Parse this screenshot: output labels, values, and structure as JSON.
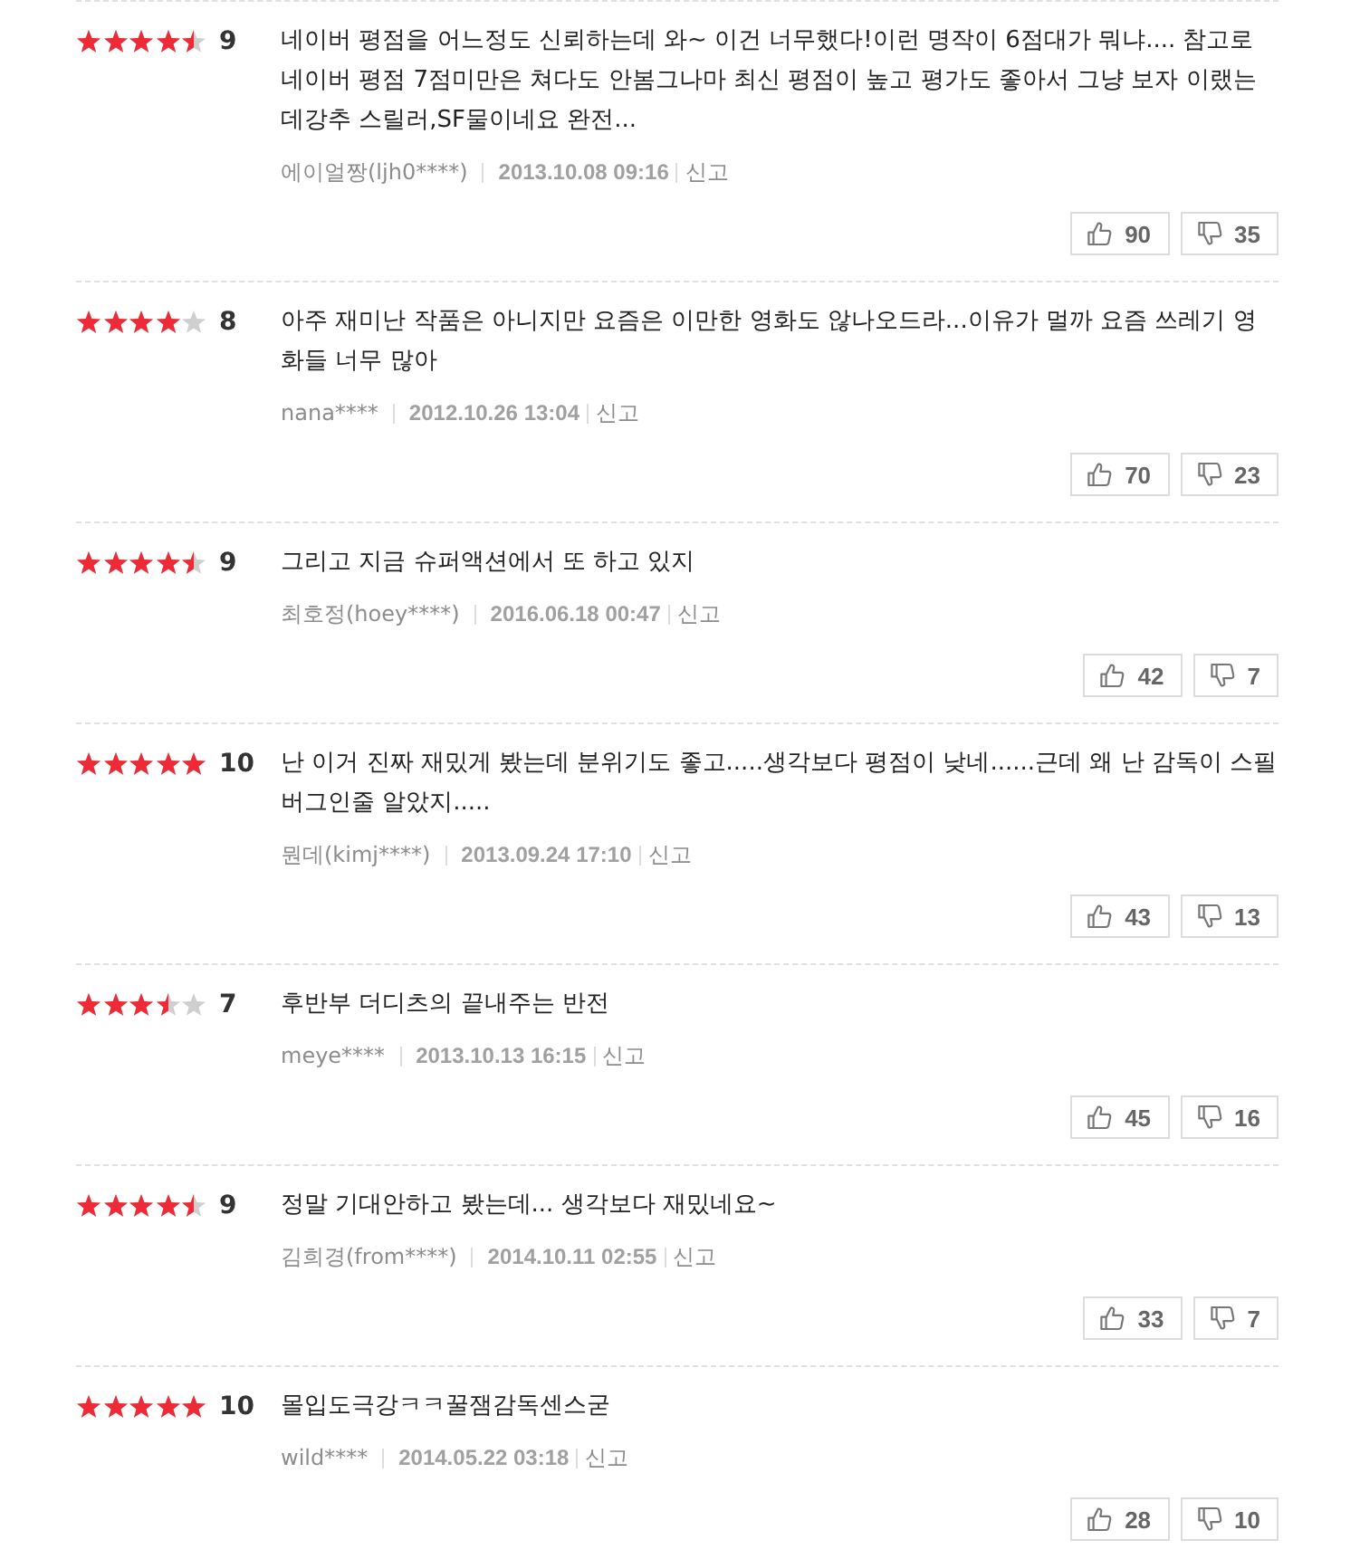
{
  "reviews": [
    {
      "stars": 4.5,
      "score": "9",
      "text": "네이버 평점을 어느정도 신뢰하는데 와~ 이건 너무했다!이런 명작이 6점대가 뭐냐.... 참고로 네이버 평점 7점미만은 쳐다도 안봄그나마 최신 평점이 높고 평가도 좋아서 그냥 보자 이랬는데강추 스릴러,SF물이네요 완전...",
      "author": "에이얼짱(ljh0****)",
      "date": "2013.10.08 09:16",
      "report": "신고",
      "likes": "90",
      "dislikes": "35"
    },
    {
      "stars": 4,
      "score": "8",
      "text": "아주 재미난 작품은 아니지만 요즘은 이만한 영화도 않나오드라...이유가 멀까 요즘 쓰레기 영화들 너무 많아",
      "author": "nana****",
      "date": "2012.10.26 13:04",
      "report": "신고",
      "likes": "70",
      "dislikes": "23"
    },
    {
      "stars": 4.5,
      "score": "9",
      "text": "그리고 지금 슈퍼액션에서 또 하고 있지",
      "author": "최호정(hoey****)",
      "date": "2016.06.18 00:47",
      "report": "신고",
      "likes": "42",
      "dislikes": "7"
    },
    {
      "stars": 5,
      "score": "10",
      "text": "난 이거 진짜 재밌게 봤는데 분위기도 좋고.....생각보다 평점이 낮네......근데 왜 난 감독이 스필버그인줄 알았지.....",
      "author": "뭔데(kimj****)",
      "date": "2013.09.24 17:10",
      "report": "신고",
      "likes": "43",
      "dislikes": "13"
    },
    {
      "stars": 3.5,
      "score": "7",
      "text": "후반부 더디츠의 끝내주는 반전",
      "author": "meye****",
      "date": "2013.10.13 16:15",
      "report": "신고",
      "likes": "45",
      "dislikes": "16"
    },
    {
      "stars": 4.5,
      "score": "9",
      "text": "정말 기대안하고 봤는데... 생각보다 재밌네요~",
      "author": "김희경(from****)",
      "date": "2014.10.11 02:55",
      "report": "신고",
      "likes": "33",
      "dislikes": "7"
    },
    {
      "stars": 5,
      "score": "10",
      "text": "몰입도극강ㅋㅋ꿀잼감독센스굳",
      "author": "wild****",
      "date": "2014.05.22 03:18",
      "report": "신고",
      "likes": "28",
      "dislikes": "10"
    }
  ]
}
